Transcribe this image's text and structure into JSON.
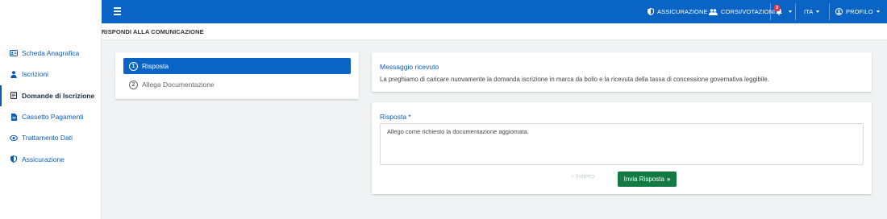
{
  "topbar": {
    "insurance_label": "ASSICURAZIONE",
    "courses_label": "CORSI/VOTAZIONI",
    "notifications_count": "3",
    "language_label": "ITA",
    "profile_label": "PROFILO"
  },
  "page": {
    "title": "RISPONDI ALLA COMUNICAZIONE"
  },
  "sidebar": {
    "items": [
      {
        "label": "Scheda Anagrafica",
        "icon": "id-card-icon"
      },
      {
        "label": "Iscrizioni",
        "icon": "user-icon"
      },
      {
        "label": "Domande di Iscrizione",
        "icon": "document-icon",
        "active": true
      },
      {
        "label": "Cassetto Pagamenti",
        "icon": "file-icon"
      },
      {
        "label": "Trattamento Dati",
        "icon": "eye-icon"
      },
      {
        "label": "Assicurazione",
        "icon": "shield-icon"
      }
    ]
  },
  "steps": [
    {
      "number": "1",
      "label": "Risposta",
      "active": true
    },
    {
      "number": "2",
      "label": "Allega Documentazione",
      "active": false
    }
  ],
  "message": {
    "title": "Messaggio ricevuto",
    "body": "La preghiamo di caricare nuovamente la domanda iscrizione in marca da bollo e la ricevuta della tassa di concessione governativa leggibile."
  },
  "answer": {
    "label": "Risposta *",
    "value": "Allego come richiesto la documentazione aggiornata.",
    "back_label": "« Indietro",
    "send_label": "Invia Risposta"
  },
  "colors": {
    "primary": "#0a64c6",
    "success": "#117a45",
    "badge": "#d9364f"
  }
}
